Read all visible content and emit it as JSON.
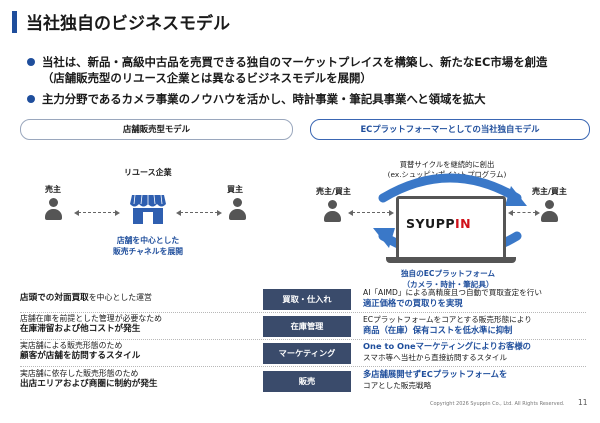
{
  "title": "当社独自のビジネスモデル",
  "bullets": [
    {
      "line1": "当社は、新品・高級中古品を売買できる独自のマーケットプレイスを構築し、新たなEC市場を創造",
      "line2": "（店舗販売型のリユース企業とは異なるビジネスモデルを展開）"
    },
    {
      "line1": "主力分野であるカメラ事業のノウハウを活かし、時計事業・筆記具事業へと領域を拡大",
      "line2": ""
    }
  ],
  "left_panel": {
    "header": "店舗販売型モデル",
    "company": "リユース企業",
    "seller": "売主",
    "buyer": "買主",
    "store_note": [
      "店舗を中心とした",
      "販売チャネルを展開"
    ]
  },
  "right_panel": {
    "header": "ECプラットフォーマーとしての当社独自モデル",
    "left_party": "売主/買主",
    "right_party": "売主/買主",
    "cycle_note": [
      "買替サイクルを継続的に創出",
      "(ex.シュッピンポイントプログラム)"
    ],
    "logo": "SYUPPIN",
    "platform_note": [
      "独自のECプラットフォーム",
      "（カメラ・時計・筆記具）"
    ]
  },
  "table": [
    {
      "left_prefix": "",
      "left_bold": "店頭での対面買取",
      "left_suffix": "を中心とした運営",
      "left_line2": "",
      "label": "買取・仕入れ",
      "right_line1": "AI「AIMD」による高精度且つ自動で買取査定を行い",
      "right_line2": "適正価格での買取りを実現"
    },
    {
      "left_prefix": "店舗在庫を前提とした管理が必要なため",
      "left_bold": "",
      "left_suffix": "",
      "left_line2": "在庫滞留および他コストが発生",
      "label": "在庫管理",
      "right_line1": "ECプラットフォームをコアとする販売形態により",
      "right_line2": "商品（在庫）保有コストを低水準に抑制"
    },
    {
      "left_prefix": "実店舗による販売形態のため",
      "left_bold": "",
      "left_suffix": "",
      "left_line2": "顧客が店舗を訪問するスタイル",
      "label": "マーケティング",
      "right_line1": "One to Oneマーケティングによりお客様の",
      "right_line2": "スマホ等へ当社から直接訪問するスタイル"
    },
    {
      "left_prefix": "実店舗に依存した販売形態のため",
      "left_bold": "",
      "left_suffix": "",
      "left_line2": "出店エリアおよび商圏に制約が発生",
      "label": "販売",
      "right_line1": "多店舗展開せずECプラットフォームを",
      "right_line2": "コアとした販売戦略"
    }
  ],
  "footer": "Copyright 2026 Syuppin Co., Ltd. All Rights Reserved.",
  "page_number": "11",
  "colors": {
    "accent": "#1f4e9c",
    "label_bg": "#3a4b6b",
    "logo_red": "#d0121b"
  }
}
